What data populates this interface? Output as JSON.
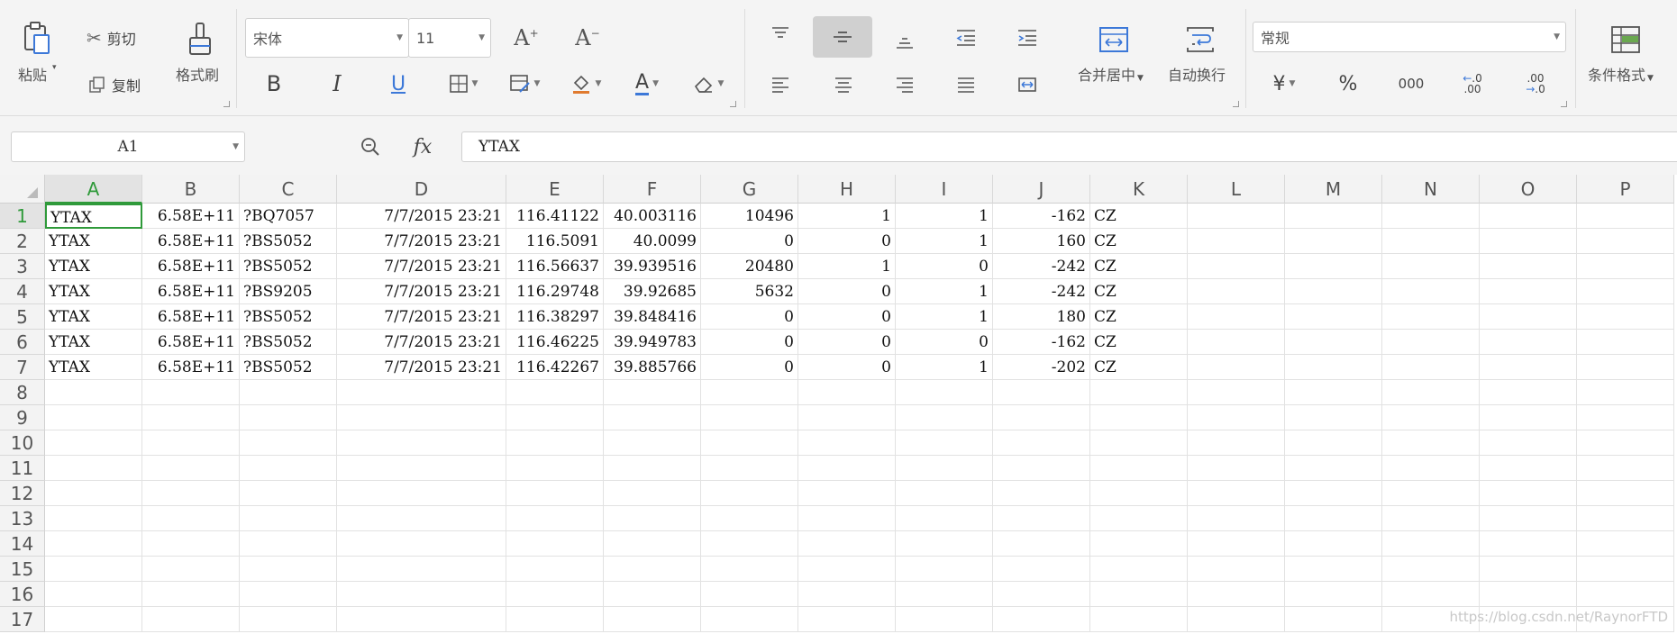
{
  "ribbon": {
    "paste": "粘贴",
    "cut": "剪切",
    "copy": "复制",
    "format_painter": "格式刷",
    "font_name": "宋体",
    "font_size": "11",
    "merge_center": "合并居中",
    "wrap_text": "自动换行",
    "number_format": "常规",
    "currency": "¥",
    "percent": "%",
    "thousands": "000",
    "dec_increase": ".00",
    "dec_decrease": ".0",
    "conditional_format": "条件格式",
    "bold": "B",
    "italic": "I",
    "underline": "U",
    "font_color": "A"
  },
  "formula_bar": {
    "cell_ref": "A1",
    "fx": "fx",
    "value": "YTAX"
  },
  "sheet": {
    "columns": [
      "A",
      "B",
      "C",
      "D",
      "E",
      "F",
      "G",
      "H",
      "I",
      "J",
      "K",
      "L",
      "M",
      "N",
      "O",
      "P"
    ],
    "rows": [
      "1",
      "2",
      "3",
      "4",
      "5",
      "6",
      "7",
      "8",
      "9",
      "10",
      "11",
      "12",
      "13",
      "14",
      "15",
      "16",
      "17"
    ],
    "data": [
      [
        "YTAX",
        "6.58E+11",
        "?BQ7057",
        "7/7/2015 23:21",
        "116.41122",
        "40.003116",
        "10496",
        "1",
        "1",
        "-162",
        "CZ"
      ],
      [
        "YTAX",
        "6.58E+11",
        "?BS5052",
        "7/7/2015 23:21",
        "116.5091",
        "40.0099",
        "0",
        "0",
        "1",
        "160",
        "CZ"
      ],
      [
        "YTAX",
        "6.58E+11",
        "?BS5052",
        "7/7/2015 23:21",
        "116.56637",
        "39.939516",
        "20480",
        "1",
        "0",
        "-242",
        "CZ"
      ],
      [
        "YTAX",
        "6.58E+11",
        "?BS9205",
        "7/7/2015 23:21",
        "116.29748",
        "39.92685",
        "5632",
        "0",
        "1",
        "-242",
        "CZ"
      ],
      [
        "YTAX",
        "6.58E+11",
        "?BS5052",
        "7/7/2015 23:21",
        "116.38297",
        "39.848416",
        "0",
        "0",
        "1",
        "180",
        "CZ"
      ],
      [
        "YTAX",
        "6.58E+11",
        "?BS5052",
        "7/7/2015 23:21",
        "116.46225",
        "39.949783",
        "0",
        "0",
        "0",
        "-162",
        "CZ"
      ],
      [
        "YTAX",
        "6.58E+11",
        "?BS5052",
        "7/7/2015 23:21",
        "116.42267",
        "39.885766",
        "0",
        "0",
        "1",
        "-202",
        "CZ"
      ]
    ]
  },
  "watermark": "https://blog.csdn.net/RaynorFTD",
  "colors": {
    "accent": "#2f9a3a",
    "active_button_bg": "#d0d0d0",
    "ribbon_bg": "#f4f4f4"
  }
}
